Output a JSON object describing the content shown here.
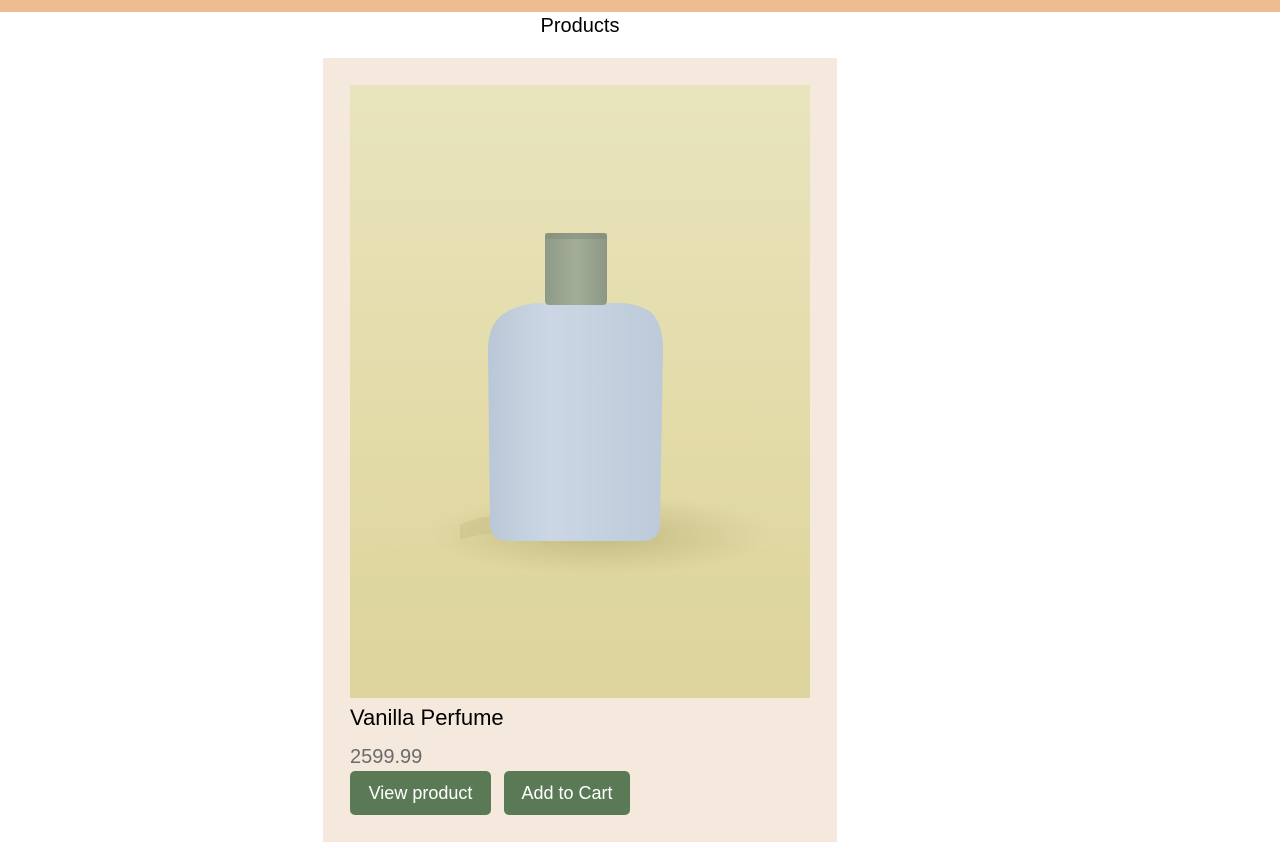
{
  "header": {
    "title": "Products",
    "bar_color": "#eebc90"
  },
  "products": [
    {
      "name": "Vanilla Perfume",
      "price": "2599.99",
      "image_icon": "perfume-bottle-photo",
      "view_label": "View product",
      "cart_label": "Add to Cart"
    }
  ],
  "colors": {
    "card_background": "#f5e8dd",
    "button": "#5a7a55",
    "price_text": "#6b6b6b"
  }
}
